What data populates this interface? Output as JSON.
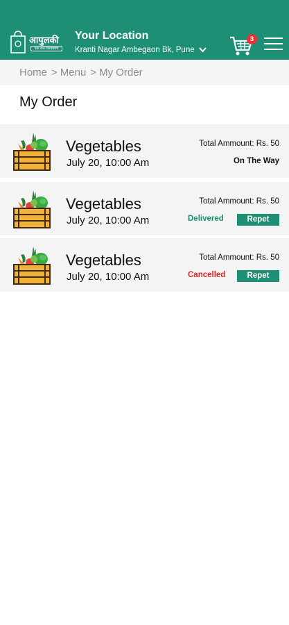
{
  "brand": {
    "logo_text": "आपुलकी",
    "logo_tagline": "एक नातं विश्वासाचं",
    "accent_color": "#1e8f74"
  },
  "header": {
    "location_title": "Your Location",
    "location_address": "Kranti Nagar Ambegaon Bk, Pune",
    "cart_count": "3",
    "icons": [
      "cart-icon",
      "menu-icon",
      "chevron-down-icon"
    ]
  },
  "breadcrumb": {
    "items": [
      "Home",
      "Menu",
      "My Order"
    ],
    "separator": ">"
  },
  "page": {
    "title": "My Order"
  },
  "orders": [
    {
      "name": "Vegetables",
      "date": "July 20, 10:00 Am",
      "amount": "Total Ammount: Rs. 50",
      "status": "On The Way",
      "status_color": "#111111",
      "action": ""
    },
    {
      "name": "Vegetables",
      "date": "July 20, 10:00 Am",
      "amount": "Total Ammount: Rs. 50",
      "status": "Delivered",
      "status_color": "#1e8f74",
      "action": "Repet"
    },
    {
      "name": "Vegetables",
      "date": "July 20, 10:00 Am",
      "amount": "Total Ammount: Rs. 50",
      "status": "Cancelled",
      "status_color": "#e32222",
      "action": "Repet"
    }
  ]
}
